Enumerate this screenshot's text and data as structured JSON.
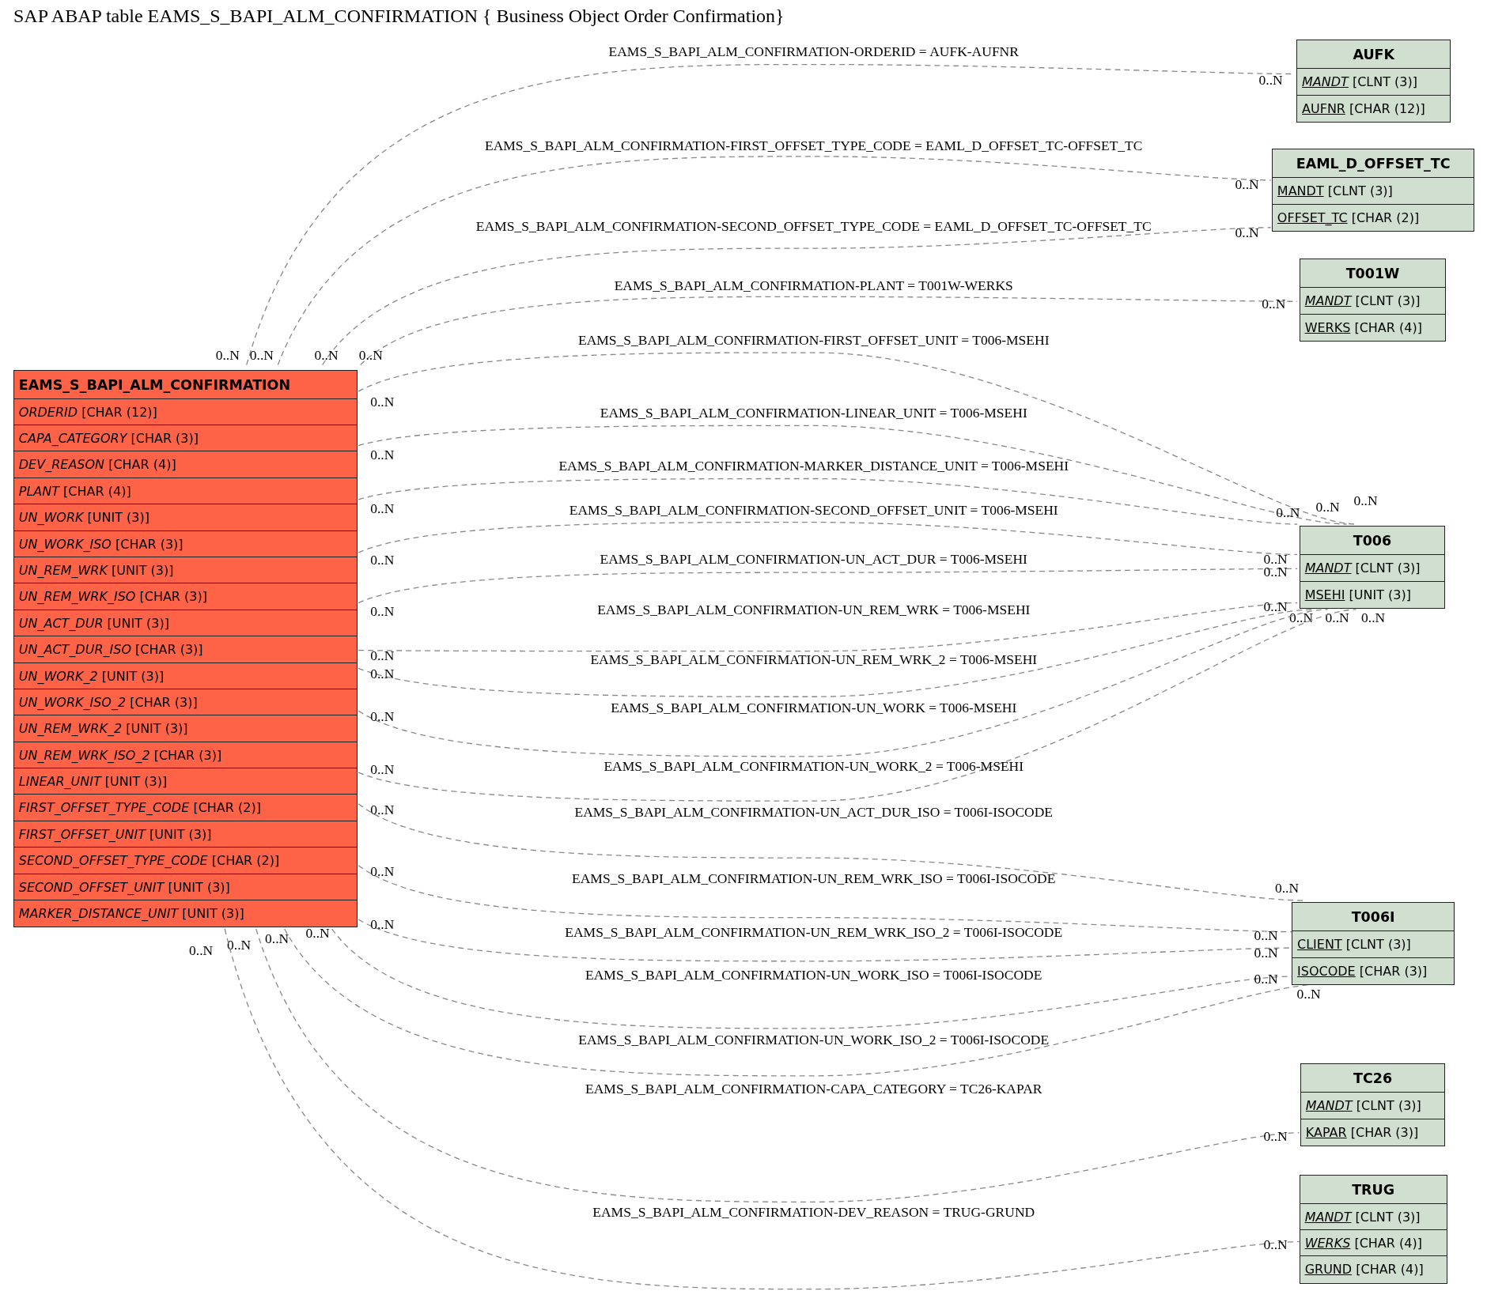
{
  "title": "SAP ABAP table EAMS_S_BAPI_ALM_CONFIRMATION { Business Object Order Confirmation}",
  "tables": [
    {
      "name": "EAMS_S_BAPI_ALM_CONFIRMATION",
      "kind": "main",
      "fields": [
        {
          "name": "ORDERID",
          "type": "[CHAR (12)]",
          "key": false,
          "foreign_key": true
        },
        {
          "name": "CAPA_CATEGORY",
          "type": "[CHAR (3)]",
          "key": false,
          "foreign_key": true
        },
        {
          "name": "DEV_REASON",
          "type": "[CHAR (4)]",
          "key": false,
          "foreign_key": true
        },
        {
          "name": "PLANT",
          "type": "[CHAR (4)]",
          "key": false,
          "foreign_key": true
        },
        {
          "name": "UN_WORK",
          "type": "[UNIT (3)]",
          "key": false,
          "foreign_key": true
        },
        {
          "name": "UN_WORK_ISO",
          "type": "[CHAR (3)]",
          "key": false,
          "foreign_key": true
        },
        {
          "name": "UN_REM_WRK",
          "type": "[UNIT (3)]",
          "key": false,
          "foreign_key": true
        },
        {
          "name": "UN_REM_WRK_ISO",
          "type": "[CHAR (3)]",
          "key": false,
          "foreign_key": true
        },
        {
          "name": "UN_ACT_DUR",
          "type": "[UNIT (3)]",
          "key": false,
          "foreign_key": true
        },
        {
          "name": "UN_ACT_DUR_ISO",
          "type": "[CHAR (3)]",
          "key": false,
          "foreign_key": true
        },
        {
          "name": "UN_WORK_2",
          "type": "[UNIT (3)]",
          "key": false,
          "foreign_key": true
        },
        {
          "name": "UN_WORK_ISO_2",
          "type": "[CHAR (3)]",
          "key": false,
          "foreign_key": true
        },
        {
          "name": "UN_REM_WRK_2",
          "type": "[UNIT (3)]",
          "key": false,
          "foreign_key": true
        },
        {
          "name": "UN_REM_WRK_ISO_2",
          "type": "[CHAR (3)]",
          "key": false,
          "foreign_key": true
        },
        {
          "name": "LINEAR_UNIT",
          "type": "[UNIT (3)]",
          "key": false,
          "foreign_key": true
        },
        {
          "name": "FIRST_OFFSET_TYPE_CODE",
          "type": "[CHAR (2)]",
          "key": false,
          "foreign_key": true
        },
        {
          "name": "FIRST_OFFSET_UNIT",
          "type": "[UNIT (3)]",
          "key": false,
          "foreign_key": true
        },
        {
          "name": "SECOND_OFFSET_TYPE_CODE",
          "type": "[CHAR (2)]",
          "key": false,
          "foreign_key": true
        },
        {
          "name": "SECOND_OFFSET_UNIT",
          "type": "[UNIT (3)]",
          "key": false,
          "foreign_key": true
        },
        {
          "name": "MARKER_DISTANCE_UNIT",
          "type": "[UNIT (3)]",
          "key": false,
          "foreign_key": true
        }
      ]
    },
    {
      "name": "AUFK",
      "kind": "related",
      "fields": [
        {
          "name": "MANDT",
          "type": "[CLNT (3)]",
          "key": true,
          "foreign_key": true
        },
        {
          "name": "AUFNR",
          "type": "[CHAR (12)]",
          "key": true,
          "foreign_key": false
        }
      ]
    },
    {
      "name": "EAML_D_OFFSET_TC",
      "kind": "related",
      "fields": [
        {
          "name": "MANDT",
          "type": "[CLNT (3)]",
          "key": true,
          "foreign_key": false
        },
        {
          "name": "OFFSET_TC",
          "type": "[CHAR (2)]",
          "key": true,
          "foreign_key": false
        }
      ]
    },
    {
      "name": "T001W",
      "kind": "related",
      "fields": [
        {
          "name": "MANDT",
          "type": "[CLNT (3)]",
          "key": true,
          "foreign_key": true
        },
        {
          "name": "WERKS",
          "type": "[CHAR (4)]",
          "key": true,
          "foreign_key": false
        }
      ]
    },
    {
      "name": "T006",
      "kind": "related",
      "fields": [
        {
          "name": "MANDT",
          "type": "[CLNT (3)]",
          "key": true,
          "foreign_key": true
        },
        {
          "name": "MSEHI",
          "type": "[UNIT (3)]",
          "key": true,
          "foreign_key": false
        }
      ]
    },
    {
      "name": "T006I",
      "kind": "related",
      "fields": [
        {
          "name": "CLIENT",
          "type": "[CLNT (3)]",
          "key": true,
          "foreign_key": false
        },
        {
          "name": "ISOCODE",
          "type": "[CHAR (3)]",
          "key": true,
          "foreign_key": false
        }
      ]
    },
    {
      "name": "TC26",
      "kind": "related",
      "fields": [
        {
          "name": "MANDT",
          "type": "[CLNT (3)]",
          "key": true,
          "foreign_key": true
        },
        {
          "name": "KAPAR",
          "type": "[CHAR (3)]",
          "key": true,
          "foreign_key": false
        }
      ]
    },
    {
      "name": "TRUG",
      "kind": "related",
      "fields": [
        {
          "name": "MANDT",
          "type": "[CLNT (3)]",
          "key": true,
          "foreign_key": true
        },
        {
          "name": "WERKS",
          "type": "[CHAR (4)]",
          "key": true,
          "foreign_key": true
        },
        {
          "name": "GRUND",
          "type": "[CHAR (4)]",
          "key": true,
          "foreign_key": false
        }
      ]
    }
  ],
  "relations": [
    {
      "label": "EAMS_S_BAPI_ALM_CONFIRMATION-ORDERID = AUFK-AUFNR",
      "source_cardinality": "0..N",
      "target_cardinality": "0..N"
    },
    {
      "label": "EAMS_S_BAPI_ALM_CONFIRMATION-FIRST_OFFSET_TYPE_CODE = EAML_D_OFFSET_TC-OFFSET_TC",
      "source_cardinality": "0..N",
      "target_cardinality": "0..N"
    },
    {
      "label": "EAMS_S_BAPI_ALM_CONFIRMATION-SECOND_OFFSET_TYPE_CODE = EAML_D_OFFSET_TC-OFFSET_TC",
      "source_cardinality": "0..N",
      "target_cardinality": "0..N"
    },
    {
      "label": "EAMS_S_BAPI_ALM_CONFIRMATION-PLANT = T001W-WERKS",
      "source_cardinality": "0..N",
      "target_cardinality": "0..N"
    },
    {
      "label": "EAMS_S_BAPI_ALM_CONFIRMATION-FIRST_OFFSET_UNIT = T006-MSEHI",
      "source_cardinality": "0..N",
      "target_cardinality": "0..N"
    },
    {
      "label": "EAMS_S_BAPI_ALM_CONFIRMATION-LINEAR_UNIT = T006-MSEHI",
      "source_cardinality": "0..N",
      "target_cardinality": "0..N"
    },
    {
      "label": "EAMS_S_BAPI_ALM_CONFIRMATION-MARKER_DISTANCE_UNIT = T006-MSEHI",
      "source_cardinality": "0..N",
      "target_cardinality": "0..N"
    },
    {
      "label": "EAMS_S_BAPI_ALM_CONFIRMATION-SECOND_OFFSET_UNIT = T006-MSEHI",
      "source_cardinality": "0..N",
      "target_cardinality": "0..N"
    },
    {
      "label": "EAMS_S_BAPI_ALM_CONFIRMATION-UN_ACT_DUR = T006-MSEHI",
      "source_cardinality": "0..N",
      "target_cardinality": "0..N"
    },
    {
      "label": "EAMS_S_BAPI_ALM_CONFIRMATION-UN_REM_WRK = T006-MSEHI",
      "source_cardinality": "0..N",
      "target_cardinality": "0..N"
    },
    {
      "label": "EAMS_S_BAPI_ALM_CONFIRMATION-UN_REM_WRK_2 = T006-MSEHI",
      "source_cardinality": "0..N",
      "target_cardinality": "0..N"
    },
    {
      "label": "EAMS_S_BAPI_ALM_CONFIRMATION-UN_WORK = T006-MSEHI",
      "source_cardinality": "0..N",
      "target_cardinality": "0..N"
    },
    {
      "label": "EAMS_S_BAPI_ALM_CONFIRMATION-UN_WORK_2 = T006-MSEHI",
      "source_cardinality": "0..N",
      "target_cardinality": "0..N"
    },
    {
      "label": "EAMS_S_BAPI_ALM_CONFIRMATION-UN_ACT_DUR_ISO = T006I-ISOCODE",
      "source_cardinality": "0..N",
      "target_cardinality": "0..N"
    },
    {
      "label": "EAMS_S_BAPI_ALM_CONFIRMATION-UN_REM_WRK_ISO = T006I-ISOCODE",
      "source_cardinality": "0..N",
      "target_cardinality": "0..N"
    },
    {
      "label": "EAMS_S_BAPI_ALM_CONFIRMATION-UN_REM_WRK_ISO_2 = T006I-ISOCODE",
      "source_cardinality": "0..N",
      "target_cardinality": "0..N"
    },
    {
      "label": "EAMS_S_BAPI_ALM_CONFIRMATION-UN_WORK_ISO = T006I-ISOCODE",
      "source_cardinality": "0..N",
      "target_cardinality": "0..N"
    },
    {
      "label": "EAMS_S_BAPI_ALM_CONFIRMATION-UN_WORK_ISO_2 = T006I-ISOCODE",
      "source_cardinality": "0..N",
      "target_cardinality": "0..N"
    },
    {
      "label": "EAMS_S_BAPI_ALM_CONFIRMATION-CAPA_CATEGORY = TC26-KAPAR",
      "source_cardinality": "0..N",
      "target_cardinality": "0..N"
    },
    {
      "label": "EAMS_S_BAPI_ALM_CONFIRMATION-DEV_REASON = TRUG-GRUND",
      "source_cardinality": "0..N",
      "target_cardinality": "0..N"
    }
  ]
}
